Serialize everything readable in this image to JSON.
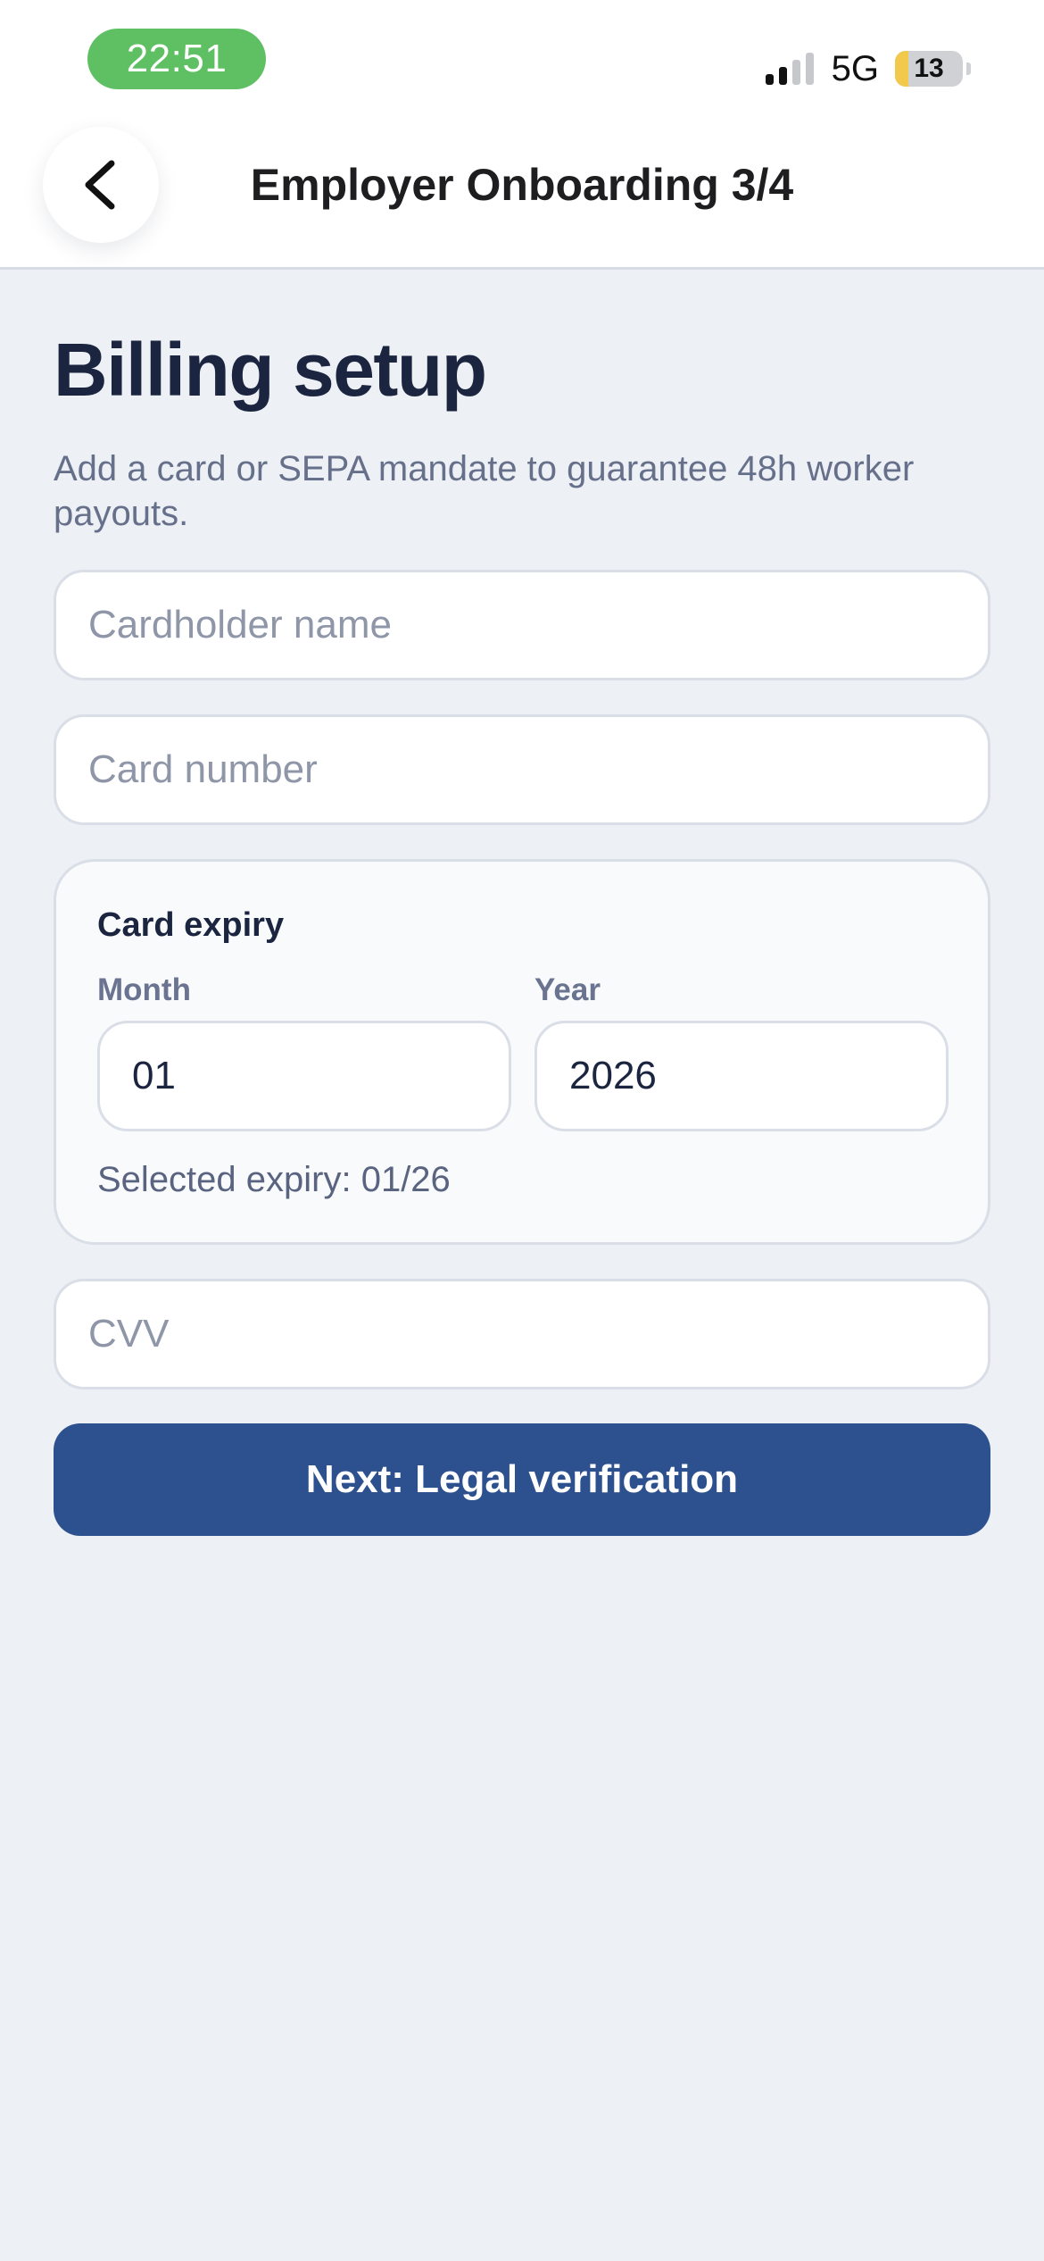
{
  "status_bar": {
    "time": "22:51",
    "network": "5G",
    "battery_level": "13",
    "signal_bars_active": 2,
    "signal_bars_total": 4,
    "time_pill_color": "#5FC063",
    "battery_fill_color": "#F2C94C"
  },
  "nav": {
    "title": "Employer Onboarding 3/4",
    "back_icon": "chevron-left-icon"
  },
  "header": {
    "title": "Billing setup",
    "subtitle": "Add a card or SEPA mandate to guarantee 48h worker payouts."
  },
  "form": {
    "cardholder": {
      "placeholder": "Cardholder name",
      "value": ""
    },
    "card_number": {
      "placeholder": "Card number",
      "value": ""
    },
    "expiry": {
      "title": "Card expiry",
      "month_label": "Month",
      "month_value": "01",
      "year_label": "Year",
      "year_value": "2026",
      "summary": "Selected expiry: 01/26"
    },
    "cvv": {
      "placeholder": "CVV",
      "value": ""
    },
    "submit_label": "Next: Legal verification"
  },
  "colors": {
    "background": "#EDF0F5",
    "primary": "#2C518E",
    "heading": "#1B2540",
    "muted_text": "#66708A"
  }
}
